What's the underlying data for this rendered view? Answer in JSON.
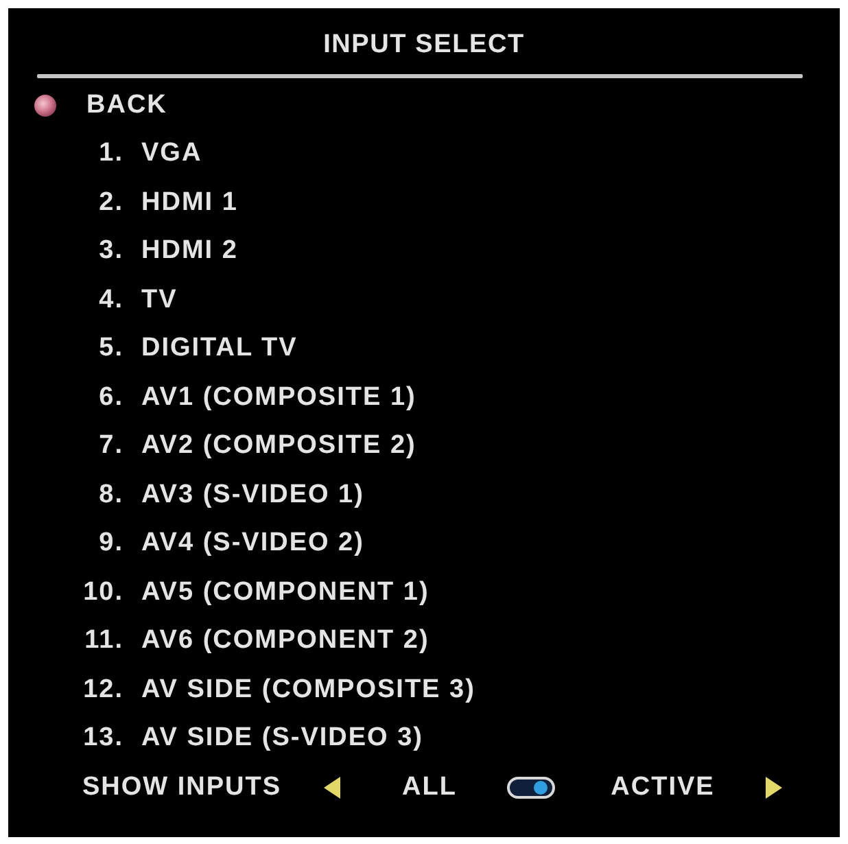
{
  "menu": {
    "title": "INPUT SELECT",
    "back": {
      "label": "BACK"
    },
    "items": [
      {
        "number": "1.",
        "label": "VGA"
      },
      {
        "number": "2.",
        "label": "HDMI 1"
      },
      {
        "number": "3.",
        "label": "HDMI 2"
      },
      {
        "number": "4.",
        "label": "TV"
      },
      {
        "number": "5.",
        "label": "DIGITAL TV"
      },
      {
        "number": "6.",
        "label": "AV1 (COMPOSITE 1)"
      },
      {
        "number": "7.",
        "label": "AV2 (COMPOSITE 2)"
      },
      {
        "number": "8.",
        "label": "AV3 (S-VIDEO 1)"
      },
      {
        "number": "9.",
        "label": "AV4 (S-VIDEO 2)"
      },
      {
        "number": "10.",
        "label": "AV5 (COMPONENT 1)"
      },
      {
        "number": "11.",
        "label": "AV6 (COMPONENT 2)"
      },
      {
        "number": "12.",
        "label": "AV SIDE (COMPOSITE 3)"
      },
      {
        "number": "13.",
        "label": "AV SIDE (S-VIDEO 3)"
      }
    ],
    "show_inputs": {
      "label": "SHOW INPUTS",
      "left_option": "ALL",
      "right_option": "ACTIVE",
      "toggle": {
        "on": true
      }
    }
  }
}
